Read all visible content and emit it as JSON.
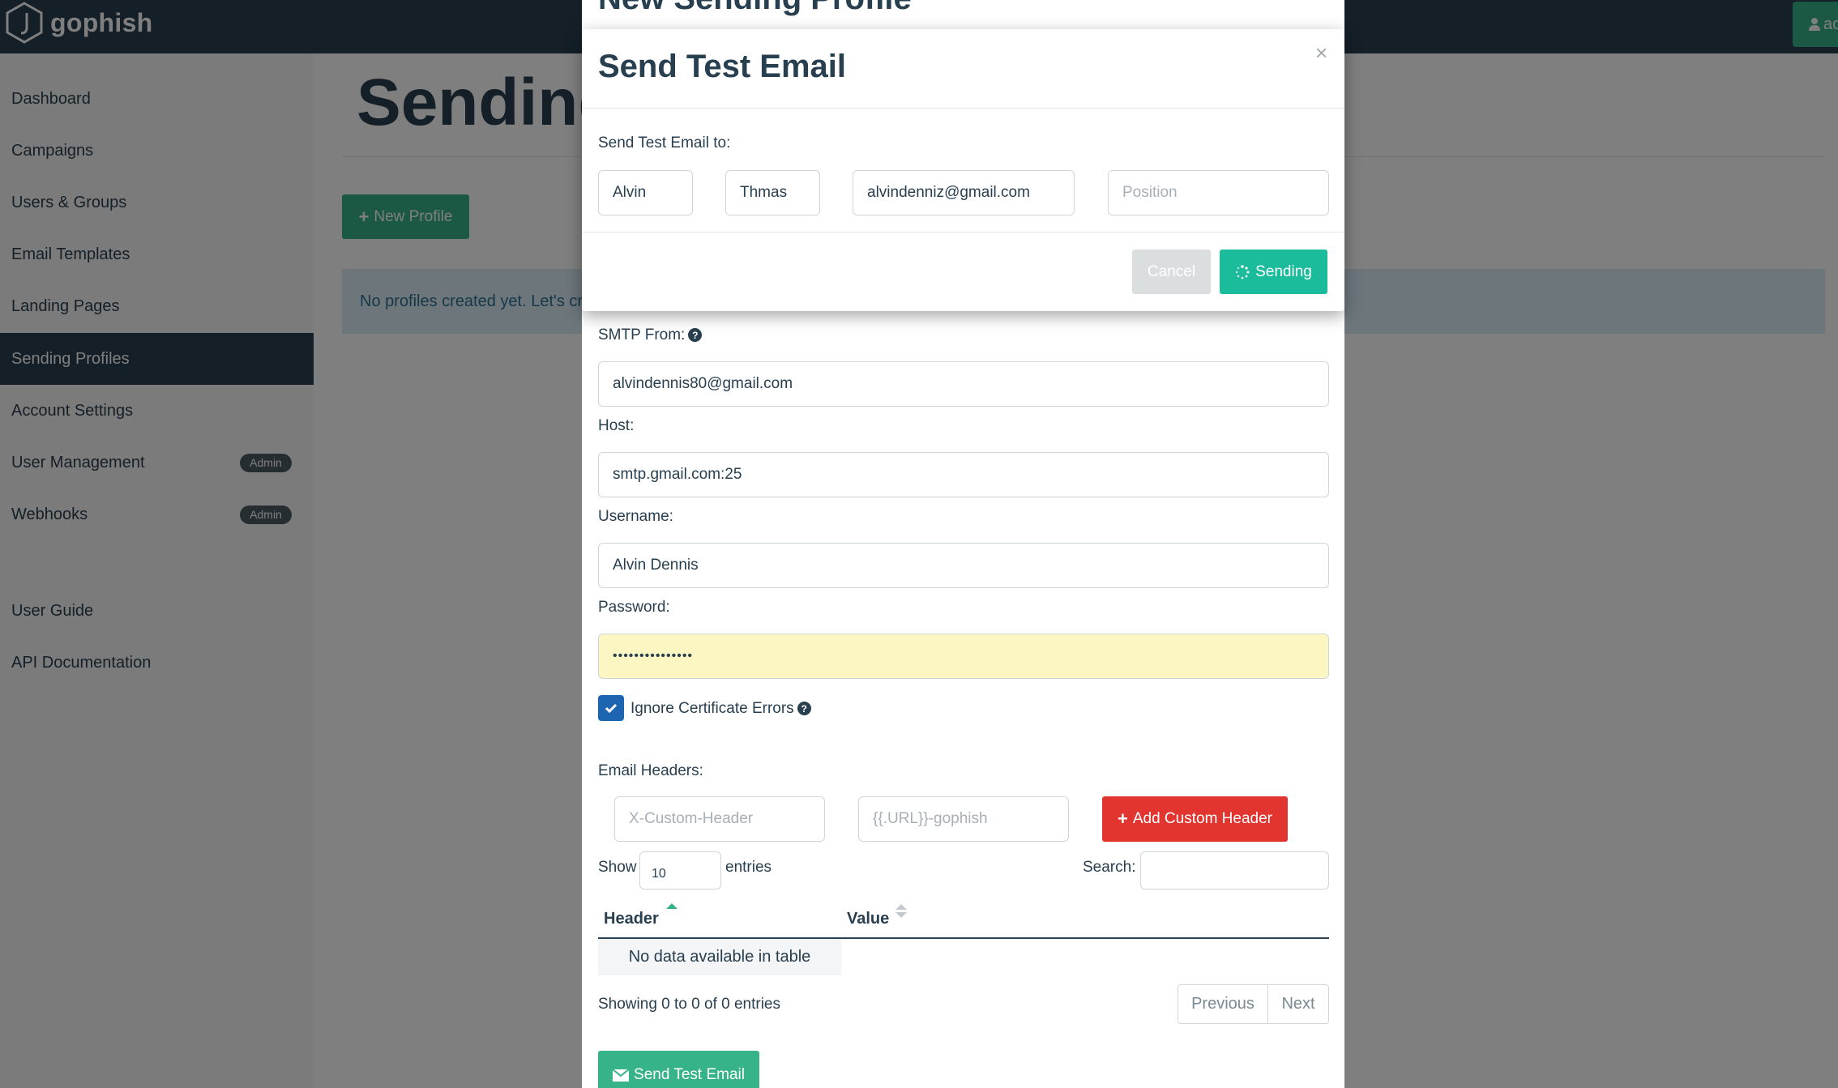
{
  "app": {
    "brand": "gophish",
    "user_label": "ac"
  },
  "sidebar": {
    "items": [
      {
        "label": "Dashboard"
      },
      {
        "label": "Campaigns"
      },
      {
        "label": "Users & Groups"
      },
      {
        "label": "Email Templates"
      },
      {
        "label": "Landing Pages"
      },
      {
        "label": "Sending Profiles"
      },
      {
        "label": "Account Settings"
      },
      {
        "label": "User Management",
        "badge": "Admin"
      },
      {
        "label": "Webhooks",
        "badge": "Admin"
      }
    ],
    "footer_items": [
      {
        "label": "User Guide"
      },
      {
        "label": "API Documentation"
      }
    ],
    "active": "Sending Profiles"
  },
  "main": {
    "title": "Sending Profiles",
    "new_profile_label": "New Profile",
    "empty_alert": "No profiles created yet. Let's create one!"
  },
  "profile_modal": {
    "title": "New Sending Profile",
    "smtp_from_label": "SMTP From:",
    "smtp_from_value": "alvindennis80@gmail.com",
    "host_label": "Host:",
    "host_value": "smtp.gmail.com:25",
    "username_label": "Username:",
    "username_value": "Alvin Dennis",
    "password_label": "Password:",
    "password_value": "•••••••••••••••",
    "ignore_cert_label": "Ignore Certificate Errors",
    "ignore_cert_checked": true,
    "headers_label": "Email Headers:",
    "header_key_placeholder": "X-Custom-Header",
    "header_value_placeholder": "{{.URL}}-gophish",
    "add_header_label": "Add Custom Header",
    "show_label": "Show",
    "entries_value": "10",
    "entries_label": "entries",
    "search_label": "Search:",
    "search_value": "",
    "columns": [
      "Header",
      "Value"
    ],
    "empty_table": "No data available in table",
    "showing_text": "Showing 0 to 0 of 0 entries",
    "previous_label": "Previous",
    "next_label": "Next",
    "send_test_label": "Send Test Email"
  },
  "test_modal": {
    "title": "Send Test Email",
    "close_label": "×",
    "to_label": "Send Test Email to:",
    "first_name": "Alvin",
    "last_name": "Thmas",
    "email": "alvindenniz@gmail.com",
    "position_placeholder": "Position",
    "cancel_label": "Cancel",
    "sending_label": "Sending"
  },
  "colors": {
    "navbar": "#283f50",
    "accent_green": "#37b38a",
    "sending_green": "#1abc9c",
    "danger_red": "#e2352f",
    "checkbox_blue": "#1d65b0",
    "password_autofill": "#fbf6c2"
  }
}
